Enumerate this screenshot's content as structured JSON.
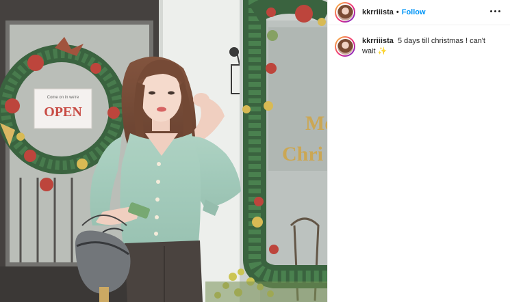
{
  "post": {
    "username": "kkrriiista",
    "separator": "•",
    "follow_label": "Follow",
    "more_icon": "more-horizontal-icon"
  },
  "caption": {
    "username": "kkrriiista",
    "text": "5 days till christmas ! can't wait",
    "emoji": "✨"
  },
  "photo": {
    "sign_text": "OPEN",
    "sign_small_text": "Come on in we're",
    "wall_text_1": "Me",
    "wall_text_2": "Chri"
  },
  "colors": {
    "follow_blue": "#0095f6",
    "text_dark": "#262626",
    "divider": "#efefef"
  }
}
